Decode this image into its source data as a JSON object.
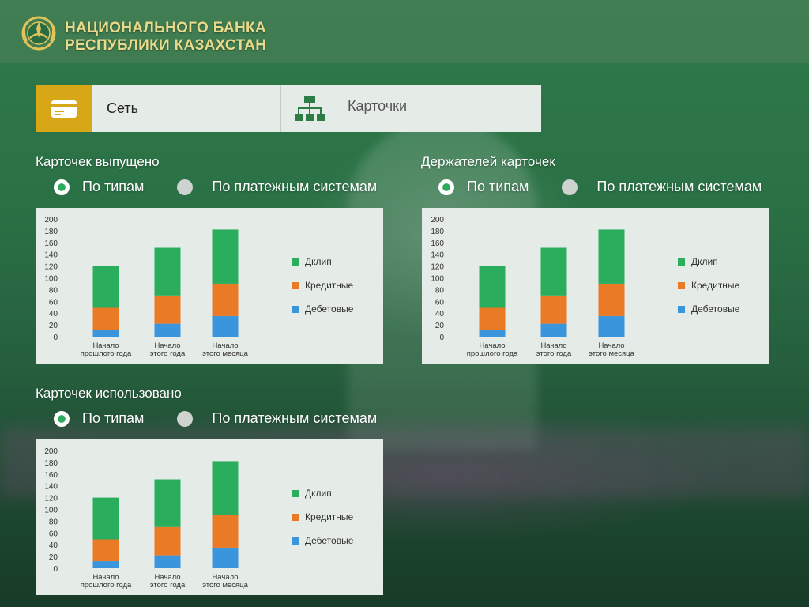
{
  "header": {
    "bank_line1": "НАЦИОНАЛЬНОГО БАНКА",
    "bank_line2": "РЕСПУБЛИКИ КАЗАХСТАН",
    "logo_icon": "bank-emblem-icon",
    "brand_color": "#e9d98a"
  },
  "tabs": [
    {
      "label": "Сеть",
      "icon": "credit-card-icon",
      "active": true
    },
    {
      "label": "Карточки",
      "icon": "hierarchy-icon",
      "active": false
    }
  ],
  "accent_color": "#d8a717",
  "sections": [
    {
      "title": "Карточек выпущено",
      "radio_types": "По типам",
      "radio_systems": "По платежным системам"
    },
    {
      "title": "Держателей карточек",
      "radio_types": "По типам",
      "radio_systems": "По платежным системам"
    },
    {
      "title": "Карточек использовано",
      "radio_types": "По типам",
      "radio_systems": "По платежным системам"
    }
  ],
  "chart_data": [
    {
      "type": "bar",
      "stacked": true,
      "categories": [
        "Начало прошлого года",
        "Начало этого года",
        "Начало этого месяца"
      ],
      "series": [
        {
          "name": "Дебетовые",
          "color": "#3a95dc",
          "values": [
            12,
            22,
            35
          ]
        },
        {
          "name": "Кредитные",
          "color": "#ea7a26",
          "values": [
            37,
            48,
            55
          ]
        },
        {
          "name": "Дклип",
          "color": "#2aae5e",
          "values": [
            71,
            81,
            92
          ]
        }
      ],
      "ylim": [
        0,
        200
      ],
      "yticks": [
        0,
        20,
        40,
        60,
        80,
        100,
        120,
        140,
        160,
        180,
        200
      ],
      "legend": "right"
    },
    {
      "type": "bar",
      "stacked": true,
      "categories": [
        "Начало прошлого года",
        "Начало этого года",
        "Начало этого месяца"
      ],
      "series": [
        {
          "name": "Дебетовые",
          "color": "#3a95dc",
          "values": [
            12,
            22,
            35
          ]
        },
        {
          "name": "Кредитные",
          "color": "#ea7a26",
          "values": [
            37,
            48,
            55
          ]
        },
        {
          "name": "Дклип",
          "color": "#2aae5e",
          "values": [
            71,
            81,
            92
          ]
        }
      ],
      "ylim": [
        0,
        200
      ],
      "yticks": [
        0,
        20,
        40,
        60,
        80,
        100,
        120,
        140,
        160,
        180,
        200
      ],
      "legend": "right"
    },
    {
      "type": "bar",
      "stacked": true,
      "categories": [
        "Начало прошлого года",
        "Начало этого года",
        "Начало этого месяца"
      ],
      "series": [
        {
          "name": "Дебетовые",
          "color": "#3a95dc",
          "values": [
            12,
            22,
            35
          ]
        },
        {
          "name": "Кредитные",
          "color": "#ea7a26",
          "values": [
            37,
            48,
            55
          ]
        },
        {
          "name": "Дклип",
          "color": "#2aae5e",
          "values": [
            71,
            81,
            92
          ]
        }
      ],
      "ylim": [
        0,
        200
      ],
      "yticks": [
        0,
        20,
        40,
        60,
        80,
        100,
        120,
        140,
        160,
        180,
        200
      ],
      "legend": "right"
    }
  ]
}
